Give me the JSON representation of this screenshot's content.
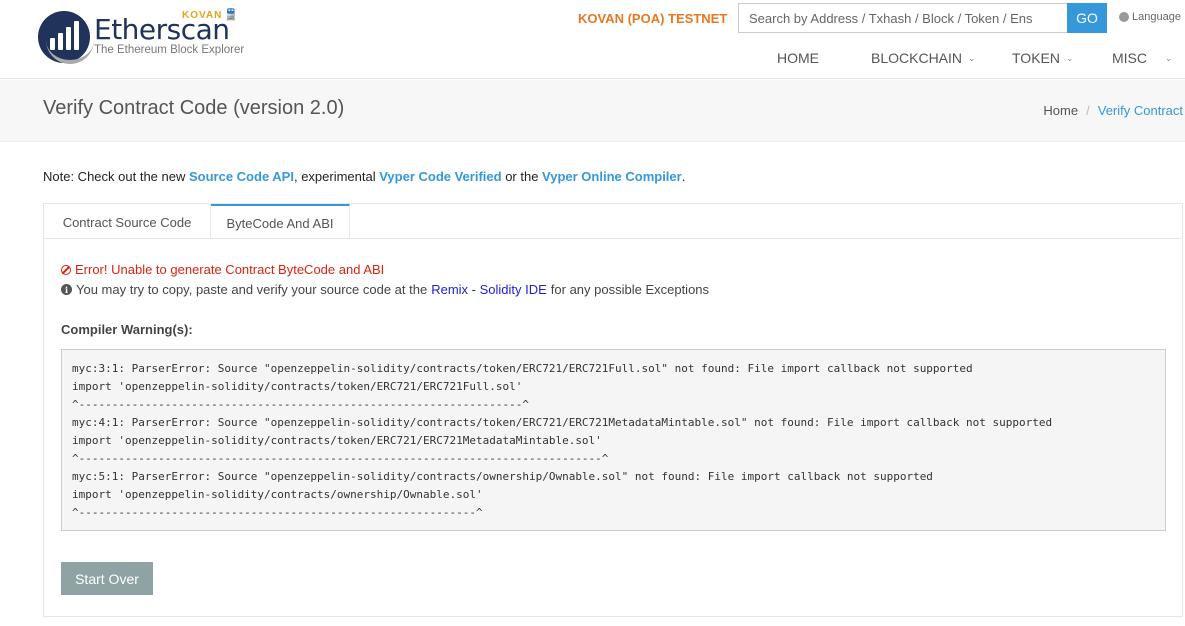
{
  "brand": {
    "name": "Etherscan",
    "tagline": "The Ethereum Block Explorer",
    "network_badge": "KOVAN"
  },
  "header": {
    "network": "KOVAN (POA) TESTNET",
    "search_placeholder": "Search by Address / Txhash / Block / Token / Ens",
    "go_label": "GO",
    "language_label": "Language",
    "nav": [
      "HOME",
      "BLOCKCHAIN",
      "TOKEN",
      "MISC"
    ]
  },
  "titlebar": {
    "title": "Verify Contract Code (version 2.0)",
    "breadcrumb_home": "Home",
    "breadcrumb_sep": "/",
    "breadcrumb_current": "Verify Contract"
  },
  "note": {
    "prefix": "Note: Check out the new ",
    "link1": "Source Code API",
    "mid1": ", experimental ",
    "link2": "Vyper Code Verified",
    "mid2": " or the ",
    "link3": "Vyper Online Compiler",
    "suffix": "."
  },
  "tabs": [
    "Contract Source Code",
    "ByteCode And ABI"
  ],
  "result": {
    "error": "Error! Unable to generate Contract ByteCode and ABI",
    "info_prefix": "You may try to copy, paste and verify your source code at the ",
    "info_link": "Remix - Solidity IDE",
    "info_suffix": " for any possible Exceptions",
    "warnings_label": "Compiler Warning(s):",
    "warnings_text": "myc:3:1: ParserError: Source \"openzeppelin-solidity/contracts/token/ERC721/ERC721Full.sol\" not found: File import callback not supported\nimport 'openzeppelin-solidity/contracts/token/ERC721/ERC721Full.sol'\n^-------------------------------------------------------------------^\nmyc:4:1: ParserError: Source \"openzeppelin-solidity/contracts/token/ERC721/ERC721MetadataMintable.sol\" not found: File import callback not supported\nimport 'openzeppelin-solidity/contracts/token/ERC721/ERC721MetadataMintable.sol'\n^-------------------------------------------------------------------------------^\nmyc:5:1: ParserError: Source \"openzeppelin-solidity/contracts/ownership/Ownable.sol\" not found: File import callback not supported\nimport 'openzeppelin-solidity/contracts/ownership/Ownable.sol'\n^------------------------------------------------------------^",
    "start_over_label": "Start Over"
  },
  "colors": {
    "accent": "#3498db",
    "network": "#e87722",
    "error": "#d9230f",
    "brand": "#21325b"
  }
}
